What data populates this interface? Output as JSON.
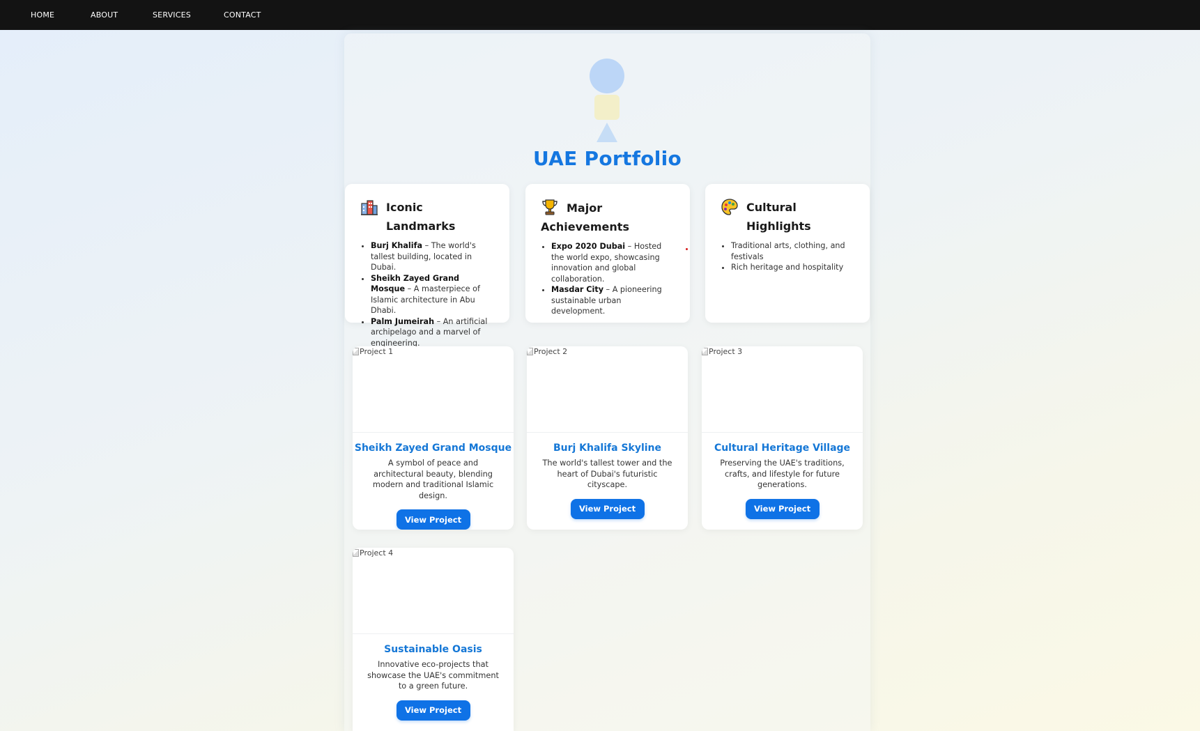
{
  "nav": {
    "items": [
      {
        "label": "HOME"
      },
      {
        "label": "ABOUT"
      },
      {
        "label": "SERVICES"
      },
      {
        "label": "CONTACT"
      }
    ]
  },
  "header": {
    "title": "UAE Portfolio"
  },
  "info_cards": [
    {
      "icon": "city-icon",
      "title": "Iconic Landmarks",
      "items": [
        {
          "bold": "Burj Khalifa",
          "text": " – The world's tallest building, located in Dubai."
        },
        {
          "bold": "Sheikh Zayed Grand Mosque",
          "text": " – A masterpiece of Islamic architecture in Abu Dhabi."
        },
        {
          "bold": "Palm Jumeirah",
          "text": " – An artificial archipelago and a marvel of engineering."
        }
      ]
    },
    {
      "icon": "trophy-icon",
      "title": "Major Achievements",
      "items": [
        {
          "bold": "Expo 2020 Dubai",
          "text": " – Hosted the world expo, showcasing innovation and global collaboration."
        },
        {
          "bold": "Masdar City",
          "text": " – A pioneering sustainable urban development."
        }
      ]
    },
    {
      "icon": "palette-icon",
      "title": "Cultural Highlights",
      "items": [
        {
          "bold": "",
          "text": "Traditional arts, clothing, and festivals"
        },
        {
          "bold": "",
          "text": "Rich heritage and hospitality"
        }
      ]
    }
  ],
  "projects": [
    {
      "img_alt": "Project 1",
      "title": "Sheikh Zayed Grand Mosque",
      "description": "A symbol of peace and architectural beauty, blending modern and traditional Islamic design.",
      "button": "View Project"
    },
    {
      "img_alt": "Project 2",
      "title": "Burj Khalifa Skyline",
      "description": "The world's tallest tower and the heart of Dubai's futuristic cityscape.",
      "button": "View Project"
    },
    {
      "img_alt": "Project 3",
      "title": "Cultural Heritage Village",
      "description": "Preserving the UAE's traditions, crafts, and lifestyle for future generations.",
      "button": "View Project"
    },
    {
      "img_alt": "Project 4",
      "title": "Sustainable Oasis",
      "description": "Innovative eco-projects that showcase the UAE's commitment to a green future.",
      "button": "View Project"
    }
  ],
  "colors": {
    "accent": "#1577e0",
    "button": "#0f72e6",
    "navbar": "#131313"
  }
}
